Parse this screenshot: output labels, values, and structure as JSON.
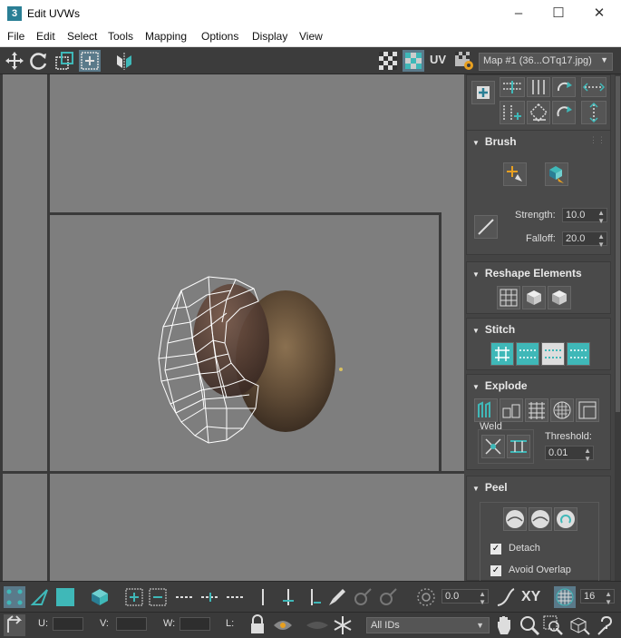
{
  "window": {
    "app_icon": "3",
    "title": "Edit UVWs"
  },
  "menu": [
    "File",
    "Edit",
    "Select",
    "Tools",
    "Mapping",
    "Options",
    "Display",
    "View"
  ],
  "toolbar": {
    "uv_label": "UV",
    "map_select": "Map #1 (36...OTq17.jpg)"
  },
  "panels": {
    "brush": {
      "title": "Brush",
      "strength_label": "Strength:",
      "strength": "10.0",
      "falloff_label": "Falloff:",
      "falloff": "20.0"
    },
    "reshape": {
      "title": "Reshape Elements"
    },
    "stitch": {
      "title": "Stitch"
    },
    "explode": {
      "title": "Explode",
      "weld_label": "Weld",
      "threshold_label": "Threshold:",
      "threshold": "0.01"
    },
    "peel": {
      "title": "Peel",
      "detach_label": "Detach",
      "detach_checked": true,
      "avoid_overlap_label": "Avoid Overlap",
      "avoid_overlap_checked": true
    }
  },
  "bottom": {
    "rotate_value": "0.0",
    "xy_label": "XY",
    "grid_value": "16",
    "u_label": "U:",
    "v_label": "V:",
    "w_label": "W:",
    "l_label": "L:",
    "ids_select": "All IDs"
  },
  "colors": {
    "accent": "#3fb8b8",
    "viewport": "#7e7e7e",
    "panel": "#444444"
  }
}
